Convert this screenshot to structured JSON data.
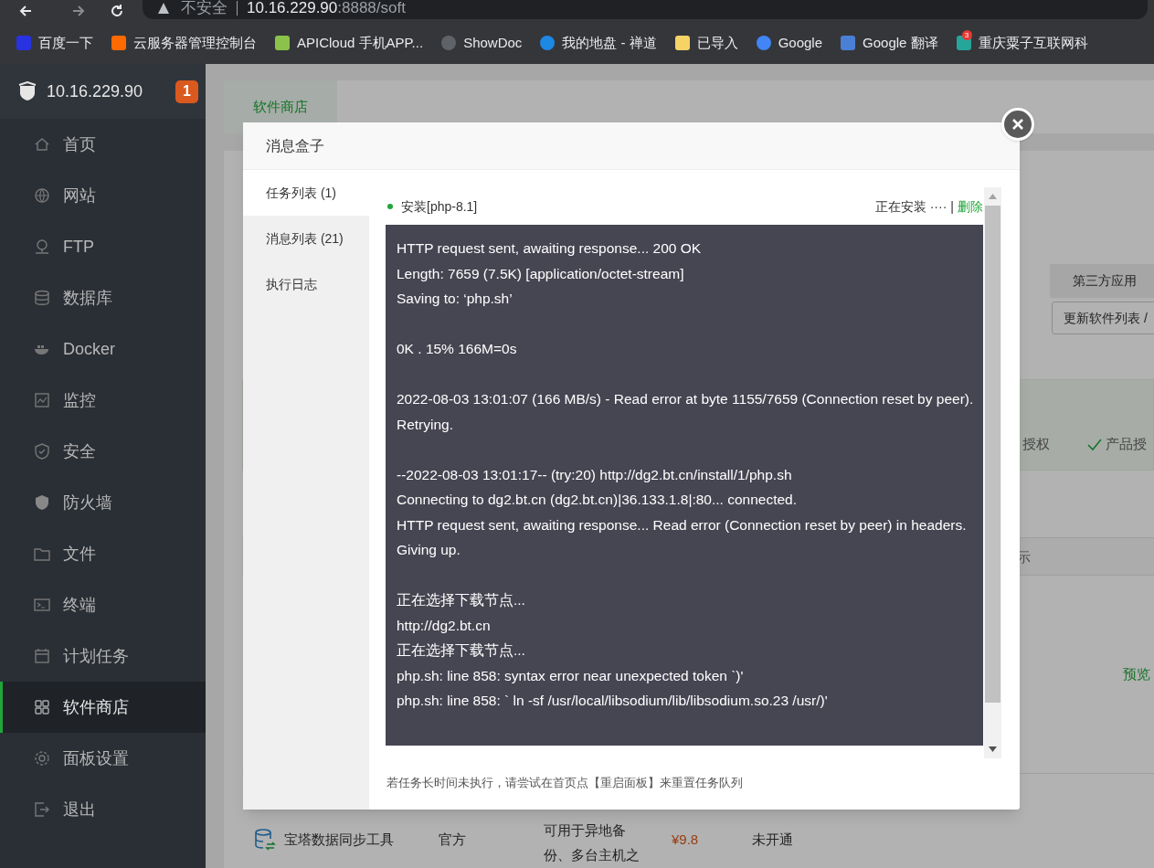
{
  "browser": {
    "security_label": "不安全",
    "address_host": "10.16.229.90",
    "address_rest": ":8888/soft",
    "bookmarks": [
      {
        "label": "百度一下",
        "color": "#2932e1"
      },
      {
        "label": "云服务器管理控制台",
        "color": "#ff6a00"
      },
      {
        "label": "APICloud 手机APP...",
        "color": "#8bc34a"
      },
      {
        "label": "ShowDoc",
        "color": "#5f6368"
      },
      {
        "label": "我的地盘 - 禅道",
        "color": "#1e88e5"
      },
      {
        "label": "已导入",
        "color": "#f6d365"
      },
      {
        "label": "Google",
        "color": "#4285f4"
      },
      {
        "label": "Google 翻译",
        "color": "#4a7fd6"
      },
      {
        "label": "重庆粟子互联网科",
        "color": "#26a69a",
        "badge": "3"
      }
    ]
  },
  "sidebar": {
    "host": "10.16.229.90",
    "badge": "1",
    "items": [
      {
        "label": "首页",
        "selected": false
      },
      {
        "label": "网站",
        "selected": false
      },
      {
        "label": "FTP",
        "selected": false
      },
      {
        "label": "数据库",
        "selected": false
      },
      {
        "label": "Docker",
        "selected": false
      },
      {
        "label": "监控",
        "selected": false
      },
      {
        "label": "安全",
        "selected": false
      },
      {
        "label": "防火墙",
        "selected": false
      },
      {
        "label": "文件",
        "selected": false
      },
      {
        "label": "终端",
        "selected": false
      },
      {
        "label": "计划任务",
        "selected": false
      },
      {
        "label": "软件商店",
        "selected": true
      },
      {
        "label": "面板设置",
        "selected": false
      },
      {
        "label": "退出",
        "selected": false
      }
    ]
  },
  "page": {
    "tab": "软件商店",
    "third_party_button": "第三方应用",
    "update_button": "更新软件列表 /",
    "auth_fragment": "授权",
    "product_auth": "产品授",
    "header_fragment": "示",
    "preview_link": "预览",
    "row": {
      "name": "宝塔数据同步工具",
      "type": "官方",
      "description": "可用于异地备份、多台主机之",
      "price": "¥9.8",
      "status": "未开通"
    }
  },
  "modal": {
    "title": "消息盒子",
    "tabs": [
      {
        "label": "任务列表 (1)",
        "selected": true
      },
      {
        "label": "消息列表 (21)",
        "selected": false
      },
      {
        "label": "执行日志",
        "selected": false
      }
    ],
    "task": {
      "name": "安装[php-8.1]",
      "status": "正在安装 ····",
      "separator": "|",
      "delete": "删除"
    },
    "log": [
      [
        "HTTP request sent, awaiting response... 200 OK",
        "Length: 7659 (7.5K) [application/octet-stream]",
        "Saving to: ‘php.sh’"
      ],
      [
        "0K . 15% 166M=0s"
      ],
      [
        "2022-08-03 13:01:07 (166 MB/s) - Read error at byte 1155/7659 (Connection reset by peer). Retrying."
      ],
      [
        "--2022-08-03 13:01:17-- (try:20) http://dg2.bt.cn/install/1/php.sh",
        "Connecting to dg2.bt.cn (dg2.bt.cn)|36.133.1.8|:80... connected.",
        "HTTP request sent, awaiting response... Read error (Connection reset by peer) in headers.",
        "Giving up."
      ],
      [
        "正在选择下载节点...",
        "http://dg2.bt.cn",
        "正在选择下载节点...",
        "php.sh: line 858: syntax error near unexpected token `)'",
        "php.sh: line 858: ` ln -sf /usr/local/libsodium/lib/libsodium.so.23 /usr/)'"
      ]
    ],
    "footer": "若任务长时间未执行，请尝试在首页点【重启面板】来重置任务队列"
  }
}
